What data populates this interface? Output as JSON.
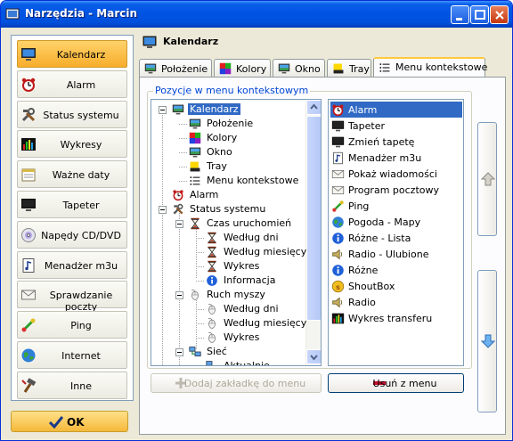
{
  "window": {
    "title": "Narzędzia - Marcin",
    "accent": "#0054e3"
  },
  "sidebar": {
    "items": [
      {
        "label": "Kalendarz",
        "icon": "calendar-monitor-icon",
        "active": true
      },
      {
        "label": "Alarm",
        "icon": "alarm-clock-icon"
      },
      {
        "label": "Status systemu",
        "icon": "tools-icon"
      },
      {
        "label": "Wykresy",
        "icon": "bar-chart-icon"
      },
      {
        "label": "Ważne daty",
        "icon": "calendar-page-icon"
      },
      {
        "label": "Tapeter",
        "icon": "wallpaper-monitor-icon"
      },
      {
        "label": "Napędy CD/DVD",
        "icon": "cd-icon"
      },
      {
        "label": "Menadżer m3u",
        "icon": "music-file-icon"
      },
      {
        "label": "Sprawdzanie poczty",
        "icon": "envelope-icon"
      },
      {
        "label": "Ping",
        "icon": "ping-icon"
      },
      {
        "label": "Internet",
        "icon": "globe-icon"
      },
      {
        "label": "Inne",
        "icon": "hammer-icon"
      }
    ],
    "ok_label": "OK"
  },
  "main": {
    "title": "Kalendarz",
    "tabs": [
      {
        "label": "Położenie",
        "icon": "monitor-icon"
      },
      {
        "label": "Kolory",
        "icon": "color-grid-icon"
      },
      {
        "label": "Okno",
        "icon": "monitor-icon"
      },
      {
        "label": "Tray",
        "icon": "tray-icon"
      },
      {
        "label": "Menu kontekstowe",
        "icon": "menu-list-icon",
        "selected": true
      }
    ],
    "group_title": "Pozycje w menu kontekstowym",
    "tree": [
      {
        "label": "Kalendarz",
        "icon": "monitor-icon",
        "selected": true
      },
      {
        "label": "Położenie",
        "icon": "monitor-icon"
      },
      {
        "label": "Kolory",
        "icon": "color-grid-icon"
      },
      {
        "label": "Okno",
        "icon": "monitor-icon"
      },
      {
        "label": "Tray",
        "icon": "tray-icon"
      },
      {
        "label": "Menu kontekstowe",
        "icon": "menu-list-icon"
      },
      {
        "label": "Alarm",
        "icon": "alarm-clock-icon"
      },
      {
        "label": "Status systemu",
        "icon": "tools-icon"
      },
      {
        "label": "Czas uruchomień",
        "icon": "hourglass-icon"
      },
      {
        "label": "Według dni",
        "icon": "hourglass-icon"
      },
      {
        "label": "Według miesięcy",
        "icon": "hourglass-icon"
      },
      {
        "label": "Wykres",
        "icon": "hourglass-icon"
      },
      {
        "label": "Informacja",
        "icon": "info-icon"
      },
      {
        "label": "Ruch myszy",
        "icon": "mouse-icon"
      },
      {
        "label": "Według dni",
        "icon": "mouse-icon"
      },
      {
        "label": "Według miesięcy",
        "icon": "mouse-icon"
      },
      {
        "label": "Wykres",
        "icon": "mouse-icon"
      },
      {
        "label": "Sieć",
        "icon": "network-icon"
      },
      {
        "label": "Aktualnie",
        "icon": "network-icon"
      },
      {
        "label": "Według dni",
        "icon": "network-icon"
      }
    ],
    "list": [
      {
        "label": "Alarm",
        "icon": "alarm-clock-icon",
        "selected": true
      },
      {
        "label": "Tapeter",
        "icon": "wallpaper-monitor-icon"
      },
      {
        "label": "Zmień tapetę",
        "icon": "wallpaper-monitor-icon"
      },
      {
        "label": "Menadżer m3u",
        "icon": "music-file-icon"
      },
      {
        "label": "Pokaż wiadomości",
        "icon": "envelope-icon"
      },
      {
        "label": "Program pocztowy",
        "icon": "envelope-icon"
      },
      {
        "label": "Ping",
        "icon": "ping-icon"
      },
      {
        "label": "Pogoda - Mapy",
        "icon": "globe-icon"
      },
      {
        "label": "Różne - Lista",
        "icon": "info-icon"
      },
      {
        "label": "Radio - Ulubione",
        "icon": "speaker-icon"
      },
      {
        "label": "Różne",
        "icon": "info-icon"
      },
      {
        "label": "ShoutBox",
        "icon": "shoutbox-icon"
      },
      {
        "label": "Radio",
        "icon": "speaker-icon"
      },
      {
        "label": "Wykres transferu",
        "icon": "bar-chart-icon"
      }
    ],
    "add_button": "Dodaj zakładkę do menu",
    "remove_button": "Usuń z menu"
  }
}
